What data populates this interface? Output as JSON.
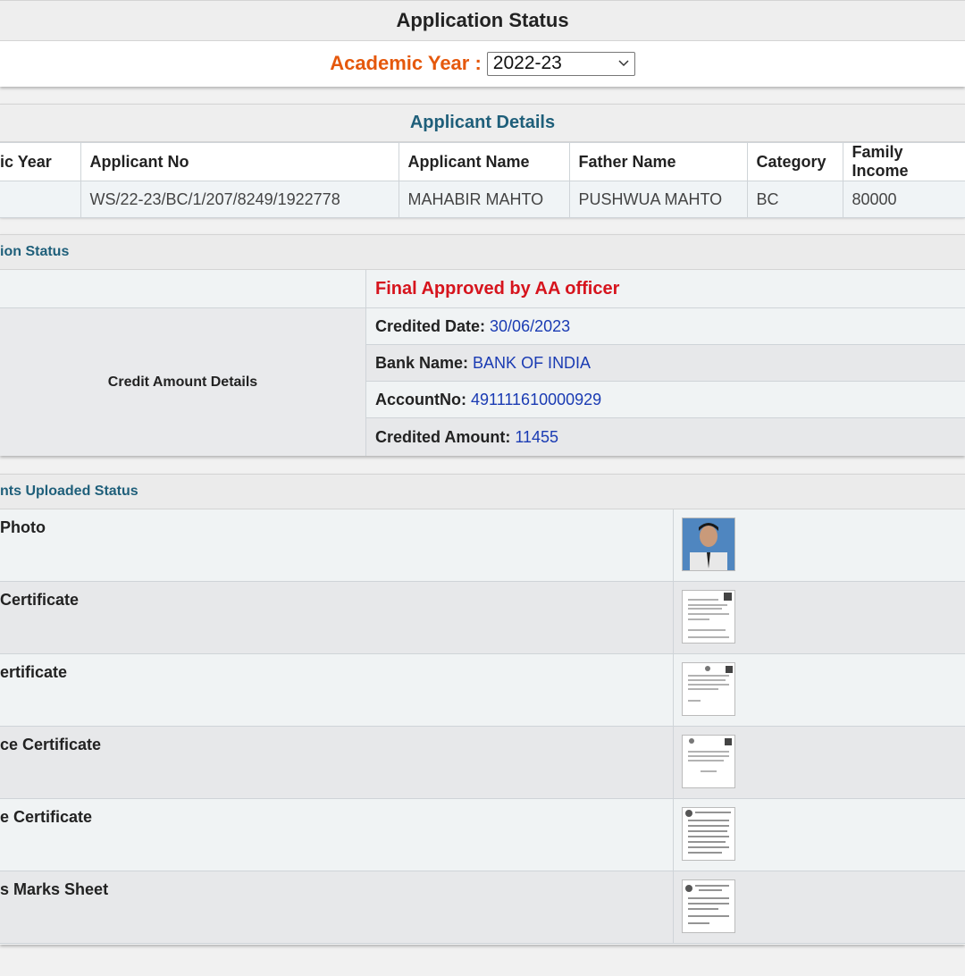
{
  "header": {
    "title": "Application Status",
    "academic_year_label": "Academic Year :",
    "academic_year_value": "2022-23"
  },
  "applicant": {
    "section_title": "Applicant Details",
    "columns": [
      "ic Year",
      "Applicant No",
      "Applicant Name",
      "Father Name",
      "Category",
      "Family Income"
    ],
    "values": [
      "",
      "WS/22-23/BC/1/207/8249/1922778",
      "MAHABIR MAHTO",
      "PUSHWUA MAHTO",
      "BC",
      "80000"
    ]
  },
  "status": {
    "section_title": "ion Status",
    "final_status": "Final Approved by AA officer",
    "credit_label": "Credit Amount Details",
    "credited_date_label": "Credited Date:",
    "credited_date": "30/06/2023",
    "bank_name_label": "Bank Name:",
    "bank_name": "BANK OF INDIA",
    "account_label": "AccountNo:",
    "account_no": "491111610000929",
    "amount_label": "Credited Amount:",
    "amount": "11455"
  },
  "documents": {
    "section_title": "nts Uploaded Status",
    "items": [
      {
        "label": " Photo",
        "thumb": "photo"
      },
      {
        "label": " Certificate",
        "thumb": "document"
      },
      {
        "label": "ertificate",
        "thumb": "document"
      },
      {
        "label": "ce Certificate",
        "thumb": "document"
      },
      {
        "label": "e Certificate",
        "thumb": "document"
      },
      {
        "label": "s Marks Sheet",
        "thumb": "document"
      }
    ]
  },
  "colors": {
    "accent_orange": "#e5580c",
    "heading_teal": "#1f5f7a",
    "status_red": "#d6141d",
    "value_blue": "#1a3bb3"
  }
}
